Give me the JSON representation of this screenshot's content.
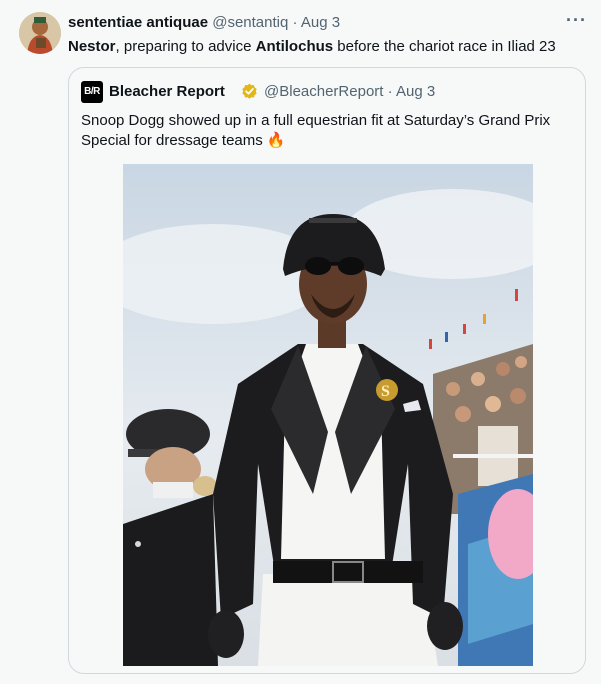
{
  "tweet": {
    "author_name": "sententiae antiquae",
    "handle": "@sentantiq",
    "separator": "·",
    "time": "Aug 3",
    "more_label": "···",
    "text_parts": [
      "Nestor",
      ", preparing to advice ",
      "Antilochus",
      " before the chariot race in Iliad 23"
    ]
  },
  "quoted": {
    "logo_text": "B/R",
    "author_name": "Bleacher Report",
    "handle": "@BleacherReport",
    "separator": "·",
    "time": "Aug 3",
    "text": "Snoop Dogg showed up in a full equestrian fit at Saturday’s Grand Prix Special for dressage teams 🔥",
    "photo_monogram": "S"
  },
  "colors": {
    "verified_badge": "#e2b719",
    "secondary_text": "#536471",
    "border": "#cfd9de"
  }
}
